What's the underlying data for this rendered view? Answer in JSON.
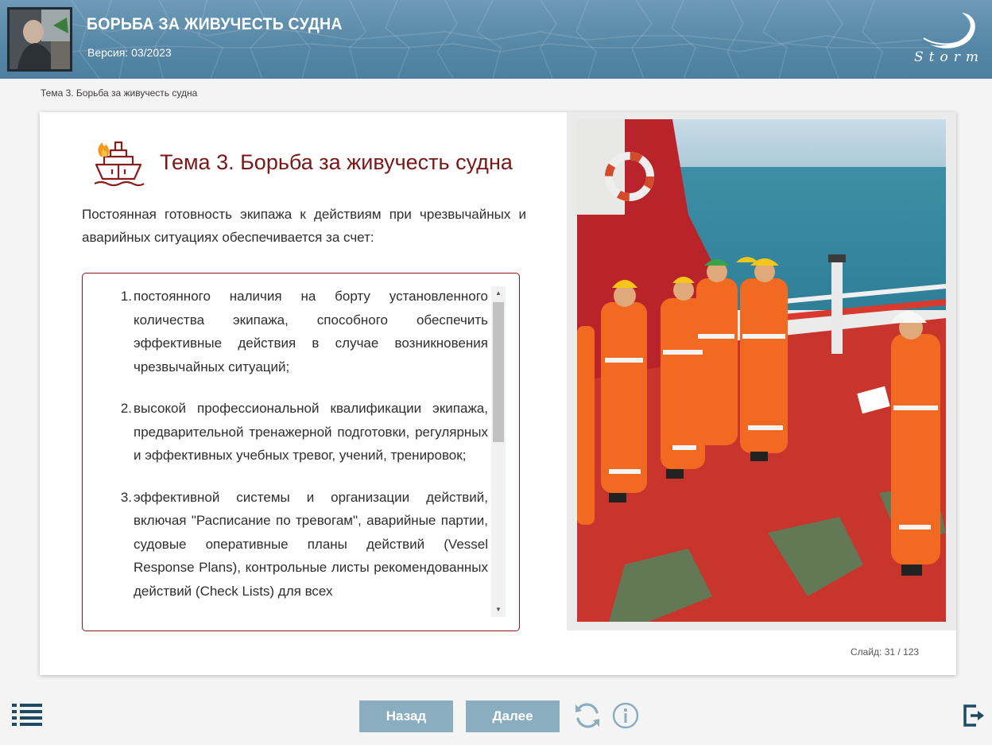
{
  "header": {
    "course_title": "БОРЬБА ЗА ЖИВУЧЕСТЬ СУДНА",
    "version": "Версия: 03/2023",
    "logo_text": "Storm"
  },
  "breadcrumb": "Тема 3. Борьба за живучесть судна",
  "slide": {
    "title": "Тема 3. Борьба за живучесть судна",
    "intro": "Постоянная готовность экипажа к действиям при чрезвычайных и аварийных ситуациях обеспечивается за счет:",
    "items": [
      {
        "num": "1.",
        "text": "постоянного наличия на борту установленного количества экипажа, способного обеспечить эффективные действия в случае возникновения чрезвычайных ситуаций;"
      },
      {
        "num": "2.",
        "text": "высокой профессиональной квалификации экипажа, предварительной тренажерной подготовки, регулярных и эффективных учебных тревог, учений, тренировок;"
      },
      {
        "num": "3.",
        "text": "эффективной системы и организации действий, включая \"Расписание по тревогам\", аварийные партии, судовые оперативные планы действий (Vessel Response Plans), контрольные листы рекомендованных действий (Check Lists) для всех"
      }
    ],
    "icons": {
      "topic": "ship-fire-icon",
      "scroll_up": "scroll-up-arrow-icon",
      "scroll_down": "scroll-down-arrow-icon"
    },
    "image_alt": "crew-drill-photo"
  },
  "slide_counter": {
    "label": "Слайд:",
    "value": "31 / 123",
    "current": 31,
    "total": 123
  },
  "nav": {
    "back_label": "Назад",
    "next_label": "Далее",
    "icons": {
      "menu": "menu-list-icon",
      "reload": "reload-icon",
      "info": "info-icon",
      "exit": "exit-icon"
    }
  },
  "colors": {
    "accent": "#7a1818",
    "header": "#5b8aa8",
    "button": "#8aaebf",
    "icon": "#1e4a63"
  }
}
